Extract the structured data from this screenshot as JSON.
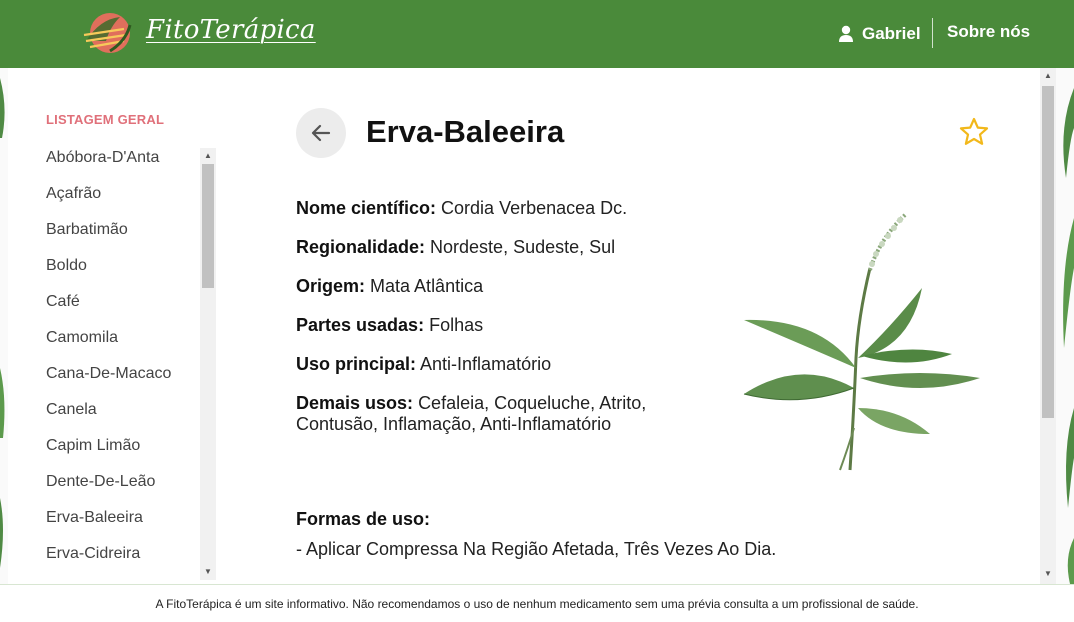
{
  "header": {
    "brand": "FitoTerápica",
    "user_name": "Gabriel",
    "about_label": "Sobre nós"
  },
  "sidebar": {
    "title": "LISTAGEM GERAL",
    "items": [
      "Abóbora-D'Anta",
      "Açafrão",
      "Barbatimão",
      "Boldo",
      "Café",
      "Camomila",
      "Cana-De-Macaco",
      "Canela",
      "Capim Limão",
      "Dente-De-Leão",
      "Erva-Baleeira",
      "Erva-Cidreira"
    ]
  },
  "plant": {
    "name": "Erva-Baleeira",
    "facts": [
      {
        "label": "Nome científico:",
        "value": "Cordia Verbenacea Dc."
      },
      {
        "label": "Regionalidade:",
        "value": "Nordeste, Sudeste, Sul"
      },
      {
        "label": "Origem:",
        "value": "Mata Atlântica"
      },
      {
        "label": "Partes usadas:",
        "value": "Folhas"
      },
      {
        "label": "Uso principal:",
        "value": "Anti-Inflamatório"
      },
      {
        "label": "Demais usos:",
        "value": "Cefaleia, Coqueluche, Atrito, Contusão, Inflamação, Anti-Inflamatório"
      }
    ],
    "uses_title": "Formas de uso:",
    "uses": [
      "- Aplicar Compressa Na Região Afetada, Três Vezes Ao Dia."
    ]
  },
  "footer": {
    "disclaimer": "A FitoTerápica é um site informativo. Não recomendamos o uso de nenhum medicamento sem uma prévia consulta a um profissional de saúde."
  },
  "colors": {
    "header_bg": "#4a8a3a",
    "sidebar_title": "#e0707a",
    "star": "#f2b81b"
  },
  "icons": {
    "logo": "leaf-hand-logo-icon",
    "user": "user-icon",
    "back": "arrow-left-icon",
    "favorite": "star-outline-icon"
  }
}
